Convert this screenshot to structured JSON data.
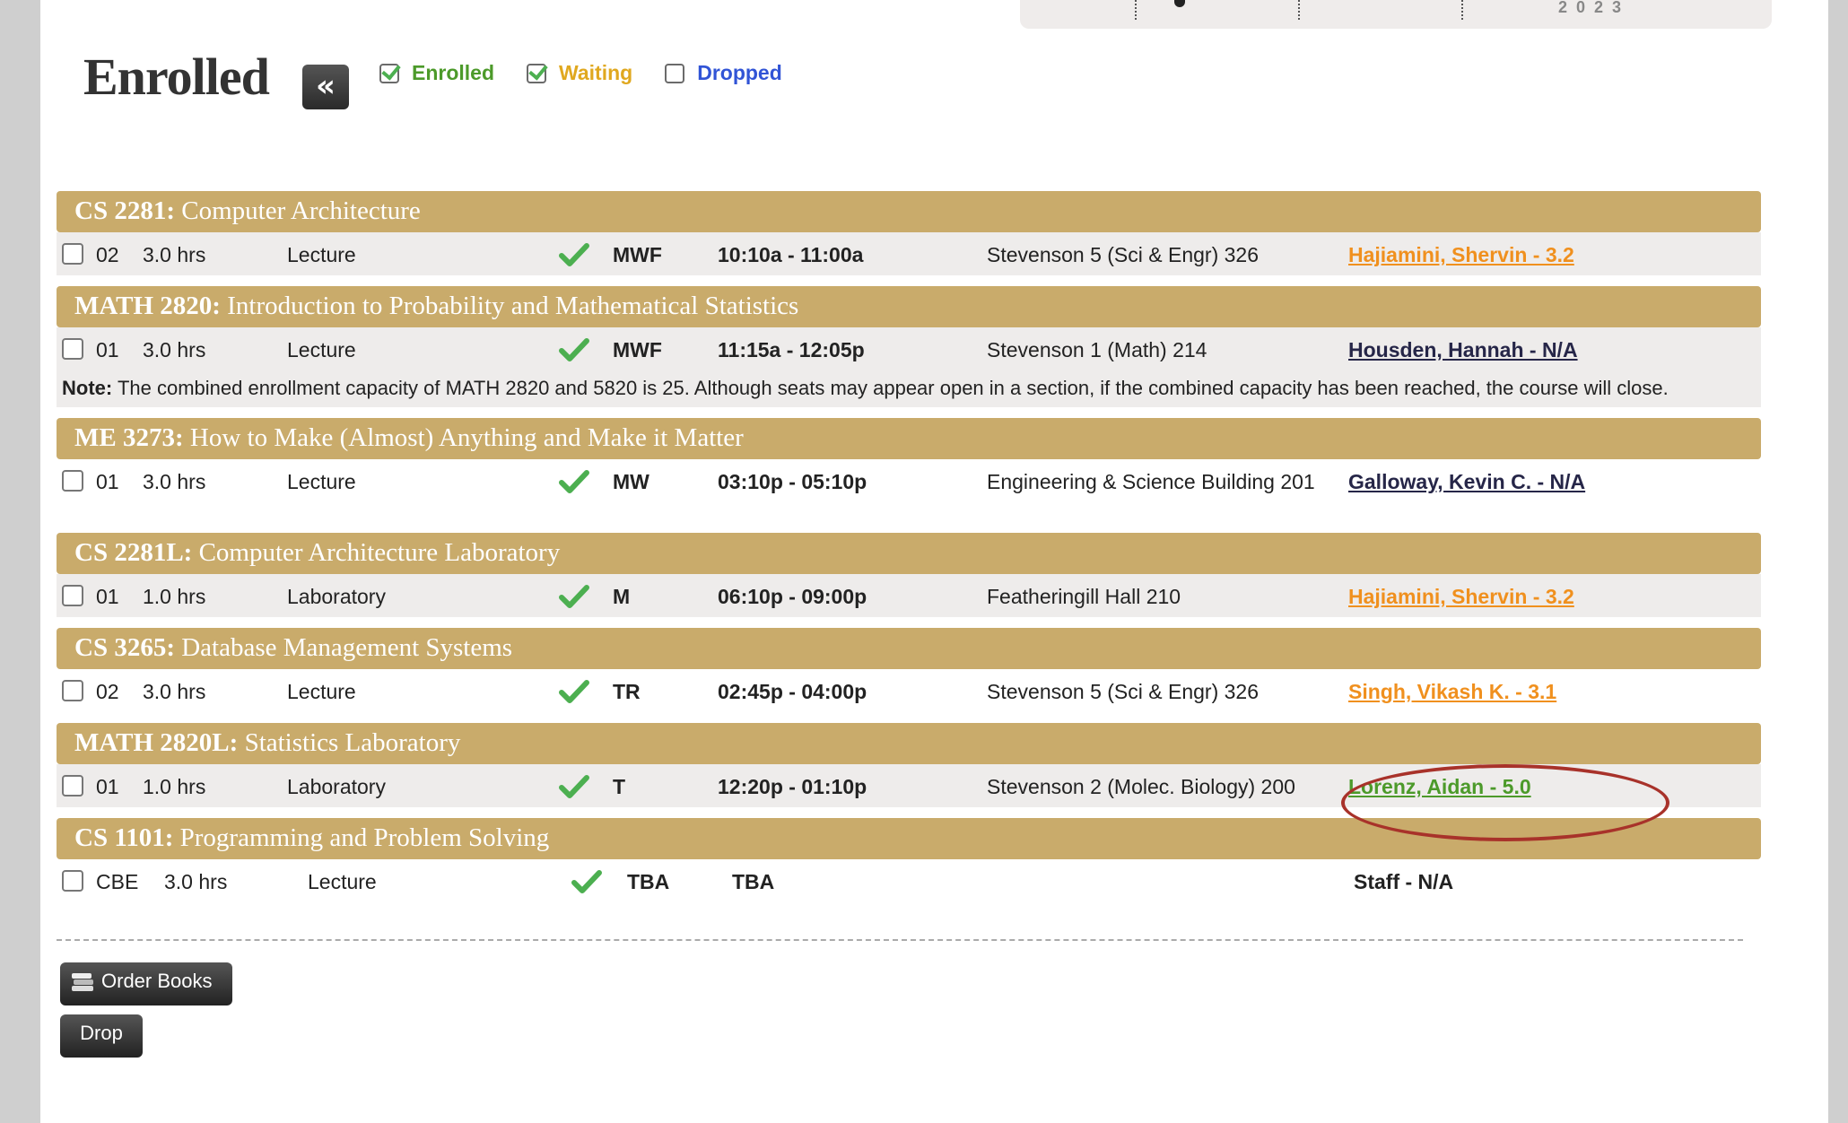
{
  "timeline": {
    "year": "2023"
  },
  "header": {
    "title": "Enrolled",
    "collapse_label": "«",
    "filters": [
      {
        "label": "Enrolled",
        "checked": true
      },
      {
        "label": "Waiting",
        "checked": true
      },
      {
        "label": "Dropped",
        "checked": false
      }
    ]
  },
  "courses": [
    {
      "code": "CS 2281:",
      "name": "Computer Architecture",
      "section": "02",
      "hours": "3.0 hrs",
      "type": "Lecture",
      "days": "MWF",
      "time": "10:10a - 11:00a",
      "location": "Stevenson 5 (Sci & Engr) 326",
      "instructor": "Hajiamini, Shervin - 3.2"
    },
    {
      "code": "MATH 2820:",
      "name": "Introduction to Probability and Mathematical Statistics",
      "section": "01",
      "hours": "3.0 hrs",
      "type": "Lecture",
      "days": "MWF",
      "time": "11:15a - 12:05p",
      "location": "Stevenson 1 (Math) 214",
      "instructor": "Housden, Hannah - N/A",
      "note_label": "Note:",
      "note": "The combined enrollment capacity of MATH 2820 and 5820 is 25. Although seats may appear open in a section, if the combined capacity has been reached, the course will close."
    },
    {
      "code": "ME 3273:",
      "name": "How to Make (Almost) Anything and Make it Matter",
      "section": "01",
      "hours": "3.0 hrs",
      "type": "Lecture",
      "days": "MW",
      "time": "03:10p - 05:10p",
      "location": "Engineering & Science Building 201",
      "instructor": "Galloway, Kevin C. - N/A"
    },
    {
      "code": "CS 2281L:",
      "name": "Computer Architecture Laboratory",
      "section": "01",
      "hours": "1.0 hrs",
      "type": "Laboratory",
      "days": "M",
      "time": "06:10p - 09:00p",
      "location": "Featheringill Hall 210",
      "instructor": "Hajiamini, Shervin - 3.2"
    },
    {
      "code": "CS 3265:",
      "name": "Database Management Systems",
      "section": "02",
      "hours": "3.0 hrs",
      "type": "Lecture",
      "days": "TR",
      "time": "02:45p - 04:00p",
      "location": "Stevenson 5 (Sci & Engr) 326",
      "instructor": "Singh, Vikash K. - 3.1"
    },
    {
      "code": "MATH 2820L:",
      "name": "Statistics Laboratory",
      "section": "01",
      "hours": "1.0 hrs",
      "type": "Laboratory",
      "days": "T",
      "time": "12:20p - 01:10p",
      "location": "Stevenson 2 (Molec. Biology) 200",
      "instructor": "Lorenz, Aidan - 5.0"
    },
    {
      "code": "CS 1101:",
      "name": "Programming and Problem Solving",
      "section": "CBE",
      "hours": "3.0 hrs",
      "type": "Lecture",
      "days": "TBA",
      "time": "TBA",
      "location": "",
      "instructor": "Staff - N/A"
    }
  ],
  "actions": {
    "order_books": "Order Books",
    "drop": "Drop"
  },
  "colors": {
    "header_gold": "#c9ab6b",
    "enrolled_green": "#4c9a2a",
    "waiting_gold": "#e0a81f",
    "dropped_blue": "#3154d6",
    "rating_orange": "#f0901e",
    "highlight_ring": "#a8322a"
  }
}
